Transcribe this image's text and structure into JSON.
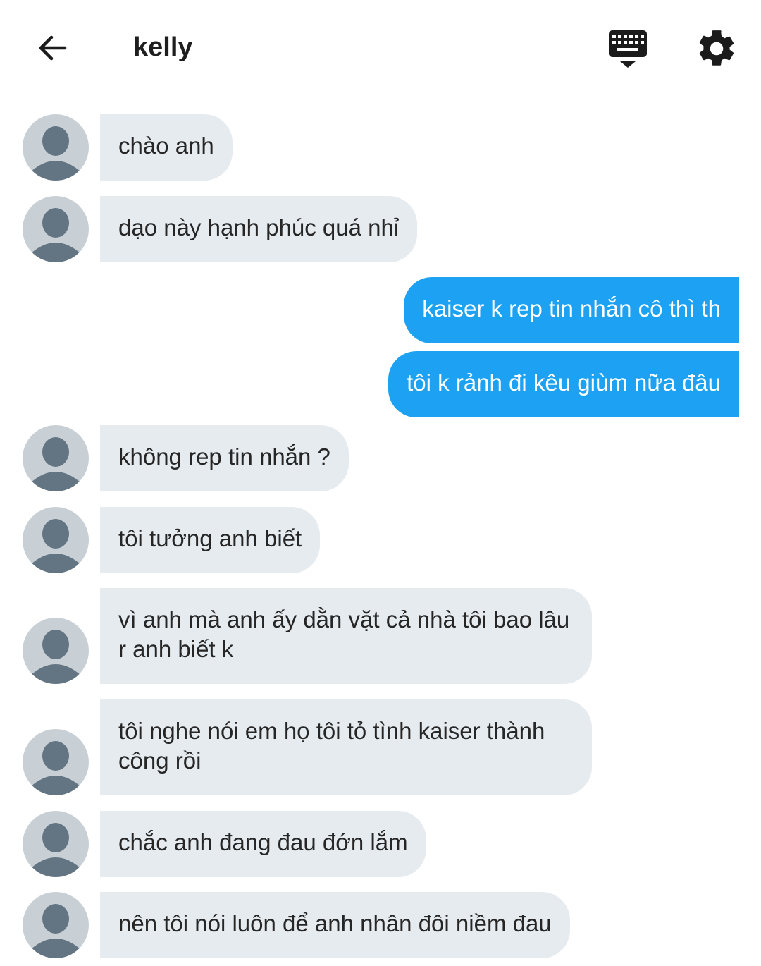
{
  "header": {
    "title": "kelly",
    "back_icon": "arrow-left-icon",
    "keyboard_icon": "keyboard-icon",
    "settings_icon": "gear-icon"
  },
  "colors": {
    "incoming_bubble": "#e6ebef",
    "outgoing_bubble": "#1da1f2",
    "avatar_bg": "#c8d0d6",
    "avatar_fg": "#637582"
  },
  "messages": [
    {
      "direction": "in",
      "text": "chào anh"
    },
    {
      "direction": "in",
      "text": "dạo này hạnh phúc quá nhỉ"
    },
    {
      "direction": "out",
      "text": "kaiser k rep tin nhắn cô thì th"
    },
    {
      "direction": "out",
      "text": "tôi k rảnh đi kêu giùm nữa đâu"
    },
    {
      "direction": "in",
      "text": "không rep tin nhắn ?"
    },
    {
      "direction": "in",
      "text": "tôi tưởng anh biết"
    },
    {
      "direction": "in",
      "text": "vì anh mà anh ấy dằn vặt cả nhà tôi bao lâu r anh biết k"
    },
    {
      "direction": "in",
      "text": "tôi nghe nói em họ tôi tỏ tình kaiser thành công rồi"
    },
    {
      "direction": "in",
      "text": "chắc anh đang đau đớn lắm"
    },
    {
      "direction": "in",
      "text": "nên tôi nói luôn để anh nhân đôi niềm đau"
    }
  ]
}
